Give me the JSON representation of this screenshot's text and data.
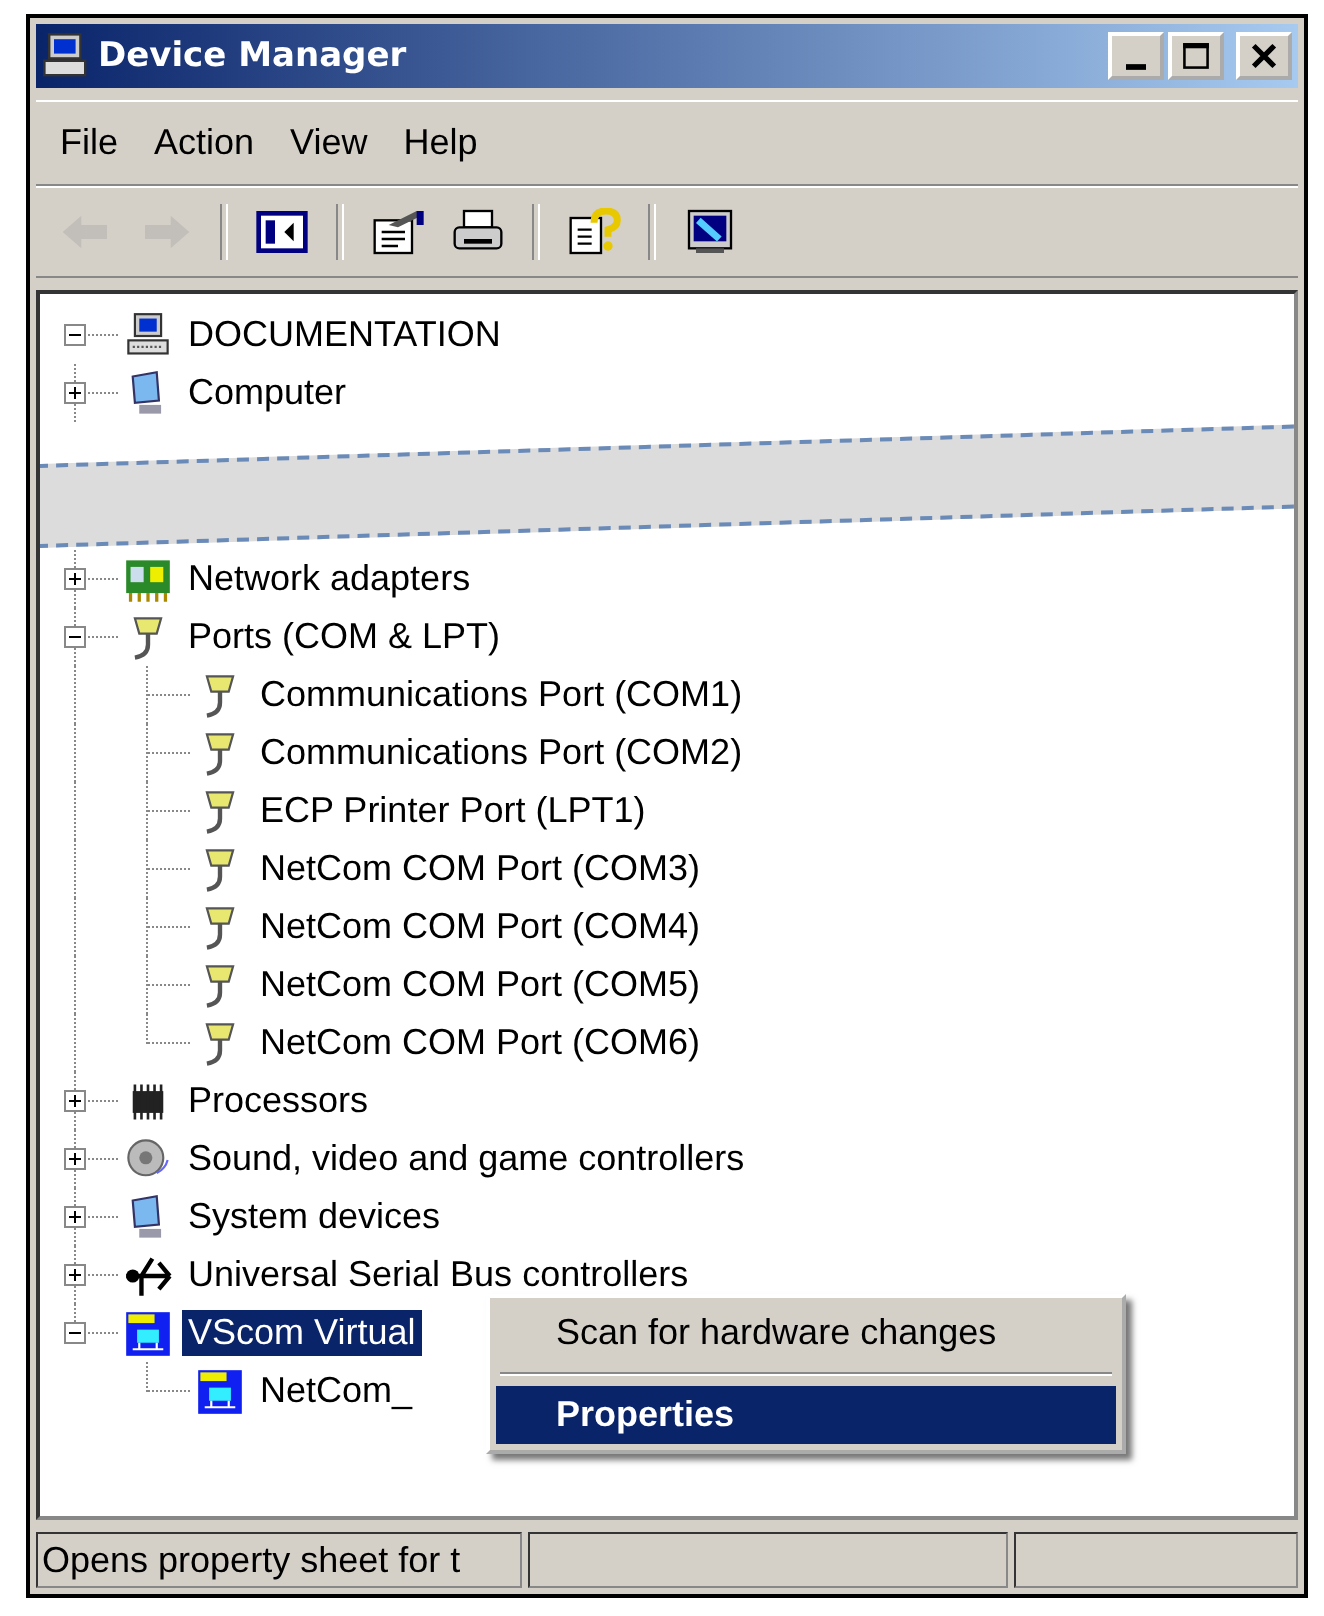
{
  "window": {
    "title": "Device Manager"
  },
  "menu": [
    {
      "label": "File"
    },
    {
      "label": "Action"
    },
    {
      "label": "View"
    },
    {
      "label": "Help"
    }
  ],
  "toolbar": [
    [
      {
        "kind": "back",
        "disabled": true
      },
      {
        "kind": "forward",
        "disabled": true
      }
    ],
    [
      {
        "kind": "tree-toggle",
        "disabled": false
      }
    ],
    [
      {
        "kind": "properties",
        "disabled": false
      },
      {
        "kind": "print",
        "disabled": false
      }
    ],
    [
      {
        "kind": "help",
        "disabled": false
      }
    ],
    [
      {
        "kind": "update",
        "disabled": false
      }
    ]
  ],
  "tree": {
    "label": "DOCUMENTATION",
    "kind": "computer",
    "expanded": true,
    "selected": false,
    "children": [
      {
        "label": "Computer",
        "kind": "monitor",
        "expanded": false,
        "selected": false
      },
      {
        "kind": "cut"
      },
      {
        "label": "Network adapters",
        "kind": "network",
        "expanded": false,
        "selected": false
      },
      {
        "label": "Ports (COM & LPT)",
        "kind": "port",
        "expanded": true,
        "selected": false,
        "children": [
          {
            "label": "Communications Port (COM1)",
            "kind": "port",
            "selected": false
          },
          {
            "label": "Communications Port (COM2)",
            "kind": "port",
            "selected": false
          },
          {
            "label": "ECP Printer Port (LPT1)",
            "kind": "port",
            "selected": false
          },
          {
            "label": "NetCom COM Port (COM3)",
            "kind": "port",
            "selected": false
          },
          {
            "label": "NetCom COM Port (COM4)",
            "kind": "port",
            "selected": false
          },
          {
            "label": "NetCom COM Port (COM5)",
            "kind": "port",
            "selected": false
          },
          {
            "label": "NetCom COM Port (COM6)",
            "kind": "port",
            "selected": false
          }
        ]
      },
      {
        "label": "Processors",
        "kind": "chip",
        "expanded": false,
        "selected": false
      },
      {
        "label": "Sound, video and game controllers",
        "kind": "speaker",
        "expanded": false,
        "selected": false
      },
      {
        "label": "System devices",
        "kind": "monitor",
        "expanded": false,
        "selected": false
      },
      {
        "label": "Universal Serial Bus controllers",
        "kind": "usb",
        "expanded": false,
        "selected": false
      },
      {
        "label": "VScom Virtual",
        "kind": "vscom",
        "expanded": true,
        "selected": true,
        "children": [
          {
            "label": "NetCom_",
            "kind": "vscom",
            "selected": false
          }
        ]
      }
    ]
  },
  "context_menu": [
    {
      "kind": "item",
      "label": "Scan for hardware changes",
      "selected": false
    },
    {
      "kind": "separator"
    },
    {
      "kind": "item",
      "label": "Properties",
      "selected": true
    }
  ],
  "status_bar": {
    "text": "Opens property sheet for t"
  }
}
